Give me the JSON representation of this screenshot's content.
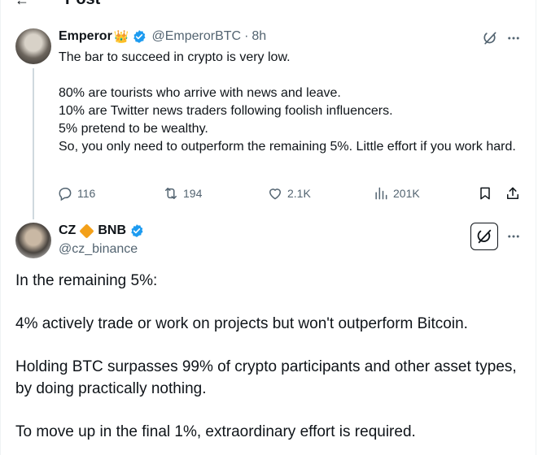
{
  "header": {
    "title": "Post"
  },
  "parent_tweet": {
    "display_name": "Emperor",
    "badge_emoji": "👑",
    "handle": "@EmperorBTC",
    "separator": "·",
    "time": "8h",
    "lines": [
      "The bar to succeed in crypto is very low.",
      "",
      "80% are tourists who arrive with news and leave.",
      "10% are Twitter news traders following foolish influencers.",
      "5% pretend to be wealthy.",
      "So, you only need to outperform the remaining 5%. Little effort if you work hard."
    ],
    "stats": {
      "replies": "116",
      "reposts": "194",
      "likes": "2.1K",
      "views": "201K"
    }
  },
  "main_tweet": {
    "display_name_a": "CZ",
    "display_name_b": "BNB",
    "handle": "@cz_binance",
    "paragraphs": [
      "In the remaining 5%:",
      "",
      "4% actively trade or work on projects but won't outperform Bitcoin.",
      "",
      "Holding BTC surpasses 99% of crypto participants and other asset types, by doing practically nothing.",
      "",
      "To move up in the final 1%, extraordinary effort is required."
    ]
  },
  "colors": {
    "verified": "#1d9bf0",
    "muted": "#536471",
    "diamond": "#f3a019"
  }
}
